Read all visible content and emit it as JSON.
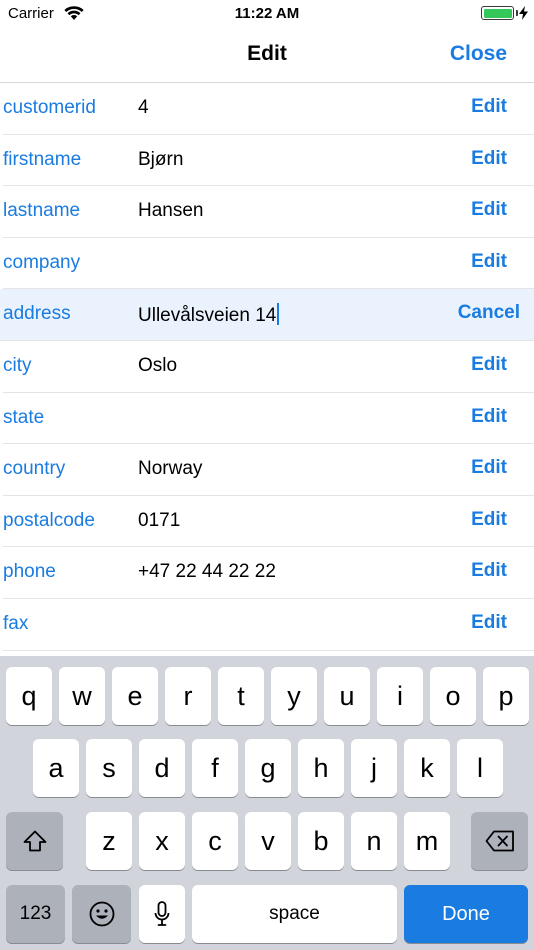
{
  "status_bar": {
    "carrier": "Carrier",
    "time": "11:22 AM",
    "battery_color": "#34c759"
  },
  "nav": {
    "title": "Edit",
    "close_label": "Close"
  },
  "accent_color": "#1a7be0",
  "fields": [
    {
      "name": "customerid",
      "value": "4",
      "action": "Edit"
    },
    {
      "name": "firstname",
      "value": "Bjørn",
      "action": "Edit"
    },
    {
      "name": "lastname",
      "value": "Hansen",
      "action": "Edit"
    },
    {
      "name": "company",
      "value": "",
      "action": "Edit"
    },
    {
      "name": "address",
      "value": "Ullevålsveien 14",
      "action": "Cancel",
      "editing": true
    },
    {
      "name": "city",
      "value": "Oslo",
      "action": "Edit"
    },
    {
      "name": "state",
      "value": "",
      "action": "Edit"
    },
    {
      "name": "country",
      "value": "Norway",
      "action": "Edit"
    },
    {
      "name": "postalcode",
      "value": "0171",
      "action": "Edit"
    },
    {
      "name": "phone",
      "value": "+47 22 44 22 22",
      "action": "Edit"
    },
    {
      "name": "fax",
      "value": "",
      "action": "Edit"
    }
  ],
  "keyboard": {
    "row1": [
      "q",
      "w",
      "e",
      "r",
      "t",
      "y",
      "u",
      "i",
      "o",
      "p"
    ],
    "row2": [
      "a",
      "s",
      "d",
      "f",
      "g",
      "h",
      "j",
      "k",
      "l"
    ],
    "row3": [
      "z",
      "x",
      "c",
      "v",
      "b",
      "n",
      "m"
    ],
    "shift_icon": "shift-icon",
    "backspace_icon": "backspace-icon",
    "numbers_label": "123",
    "emoji_icon": "emoji-icon",
    "mic_icon": "microphone-icon",
    "space_label": "space",
    "done_label": "Done"
  }
}
